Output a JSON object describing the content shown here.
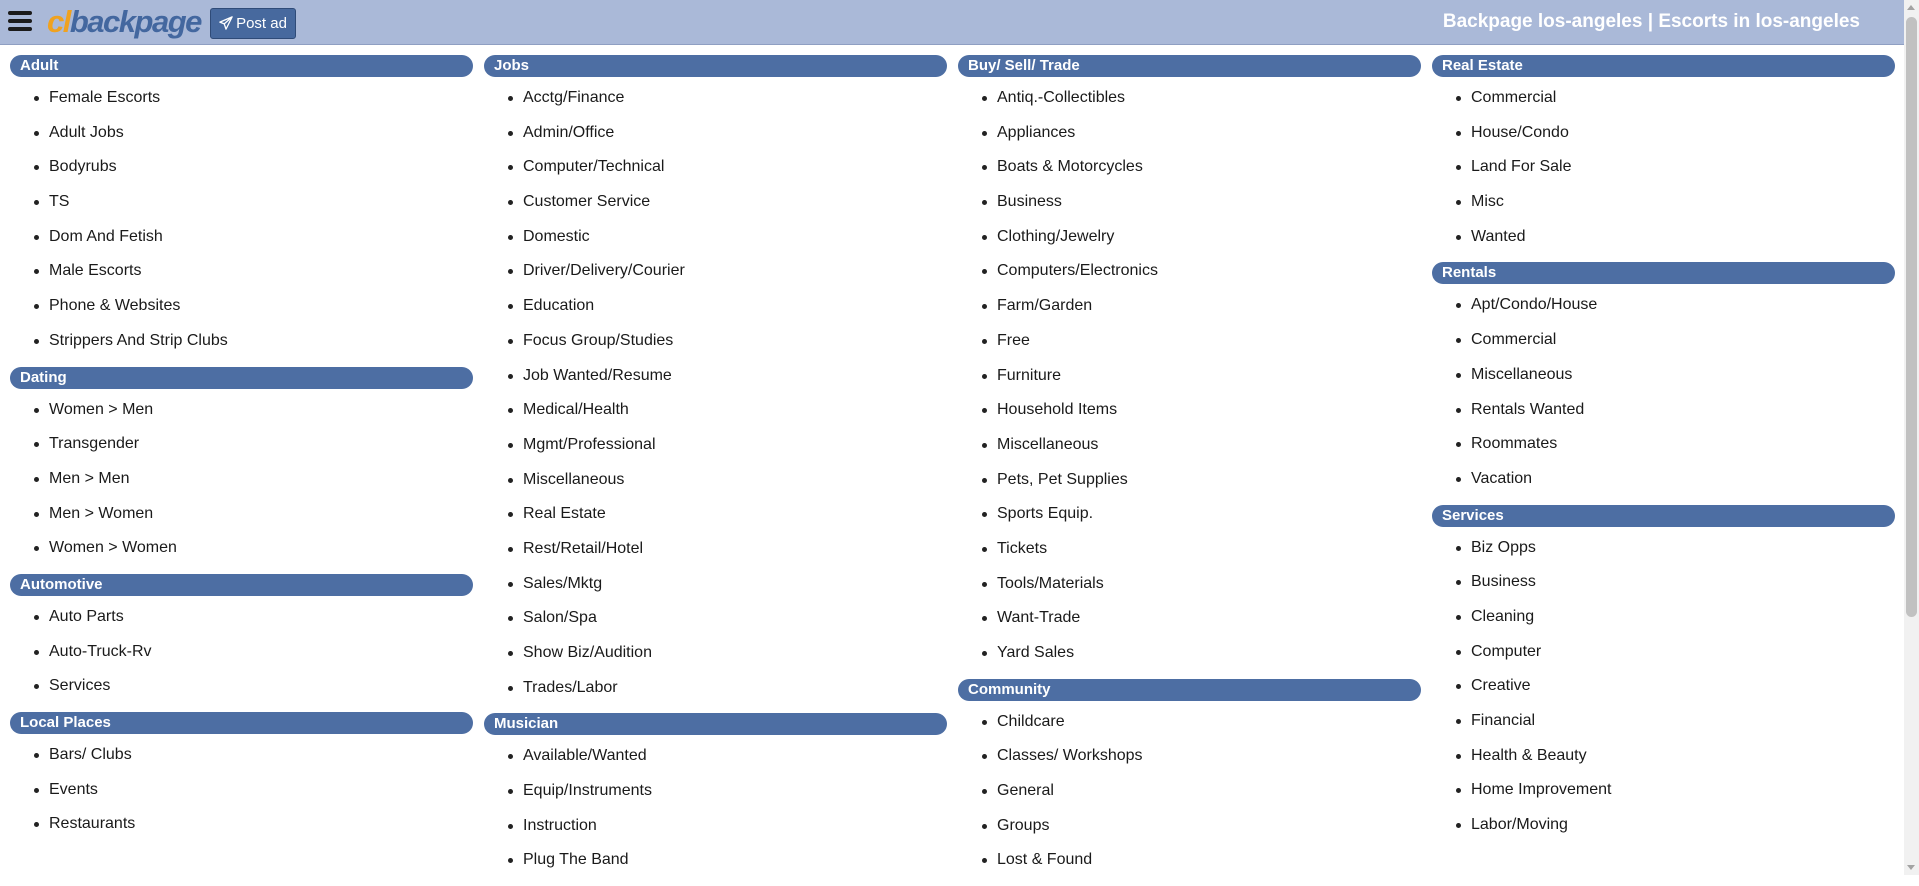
{
  "header": {
    "logo_cl": "cl",
    "logo_rest": "backpage",
    "post_label": "Post ad",
    "page_heading": "Backpage los-angeles | Escorts in los-angeles"
  },
  "colors": {
    "topbar": "#aab9d8",
    "category_header": "#4d6ea3",
    "logo_orange": "#f0a21f",
    "logo_blue": "#43679f"
  },
  "columns": [
    [
      {
        "key": "adult",
        "title": "Adult",
        "items": [
          "Female Escorts",
          "Adult Jobs",
          "Bodyrubs",
          "TS",
          "Dom And Fetish",
          "Male Escorts",
          "Phone & Websites",
          "Strippers And Strip Clubs"
        ]
      },
      {
        "key": "dating",
        "title": "Dating",
        "items": [
          "Women > Men",
          "Transgender",
          "Men > Men",
          "Men > Women",
          "Women > Women"
        ]
      },
      {
        "key": "automotive",
        "title": "Automotive",
        "items": [
          "Auto Parts",
          "Auto-Truck-Rv",
          "Services"
        ]
      },
      {
        "key": "local-places",
        "title": "Local Places",
        "items": [
          "Bars/ Clubs",
          "Events",
          "Restaurants"
        ]
      }
    ],
    [
      {
        "key": "jobs",
        "title": "Jobs",
        "items": [
          "Acctg/Finance",
          "Admin/Office",
          "Computer/Technical",
          "Customer Service",
          "Domestic",
          "Driver/Delivery/Courier",
          "Education",
          "Focus Group/Studies",
          "Job Wanted/Resume",
          "Medical/Health",
          "Mgmt/Professional",
          "Miscellaneous",
          "Real Estate",
          "Rest/Retail/Hotel",
          "Sales/Mktg",
          "Salon/Spa",
          "Show Biz/Audition",
          "Trades/Labor"
        ]
      },
      {
        "key": "musician",
        "title": "Musician",
        "items": [
          "Available/Wanted",
          "Equip/Instruments",
          "Instruction",
          "Plug The Band"
        ]
      }
    ],
    [
      {
        "key": "buy-sell-trade",
        "title": "Buy/ Sell/ Trade",
        "items": [
          "Antiq.-Collectibles",
          "Appliances",
          "Boats & Motorcycles",
          "Business",
          "Clothing/Jewelry",
          "Computers/Electronics",
          "Farm/Garden",
          "Free",
          "Furniture",
          "Household Items",
          "Miscellaneous",
          "Pets, Pet Supplies",
          "Sports Equip.",
          "Tickets",
          "Tools/Materials",
          "Want-Trade",
          "Yard Sales"
        ]
      },
      {
        "key": "community",
        "title": "Community",
        "items": [
          "Childcare",
          "Classes/ Workshops",
          "General",
          "Groups",
          "Lost & Found"
        ]
      }
    ],
    [
      {
        "key": "real-estate",
        "title": "Real Estate",
        "items": [
          "Commercial",
          "House/Condo",
          "Land For Sale",
          "Misc",
          "Wanted"
        ]
      },
      {
        "key": "rentals",
        "title": "Rentals",
        "items": [
          "Apt/Condo/House",
          "Commercial",
          "Miscellaneous",
          "Rentals Wanted",
          "Roommates",
          "Vacation"
        ]
      },
      {
        "key": "services",
        "title": "Services",
        "items": [
          "Biz Opps",
          "Business",
          "Cleaning",
          "Computer",
          "Creative",
          "Financial",
          "Health & Beauty",
          "Home Improvement",
          "Labor/Moving"
        ]
      }
    ]
  ]
}
